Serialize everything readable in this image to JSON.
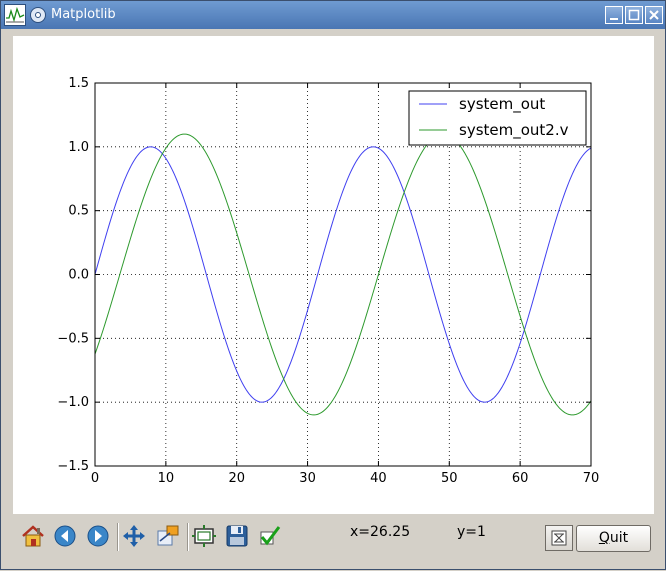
{
  "window": {
    "title": "Matplotlib"
  },
  "toolbar": {
    "coord_x": "x=26.25",
    "coord_y": "y=1",
    "quit_first": "Q",
    "quit_rest": "uit"
  },
  "chart_data": {
    "type": "line",
    "xlim": [
      0,
      70
    ],
    "ylim": [
      -1.5,
      1.5
    ],
    "xticks": [
      0,
      10,
      20,
      30,
      40,
      50,
      60,
      70
    ],
    "yticks": [
      1.5,
      1.0,
      0.5,
      0.0,
      -0.5,
      -1.0,
      -1.5
    ],
    "xtick_labels": [
      "0",
      "10",
      "20",
      "30",
      "40",
      "50",
      "60",
      "70"
    ],
    "ytick_labels": [
      "1.5",
      "1.0",
      "0.5",
      "0.0",
      "−0.5",
      "−1.0",
      "−1.5"
    ],
    "grid": true,
    "legend_position": "upper-right",
    "series": [
      {
        "name": "system_out",
        "color": "#4040f0",
        "amplitude": 1.0,
        "period": 31.42,
        "phase_x": 0.0
      },
      {
        "name": "system_out2.v",
        "color": "#2e9a2e",
        "amplitude": 1.1,
        "period": 36.5,
        "phase_x": 3.5
      }
    ]
  }
}
